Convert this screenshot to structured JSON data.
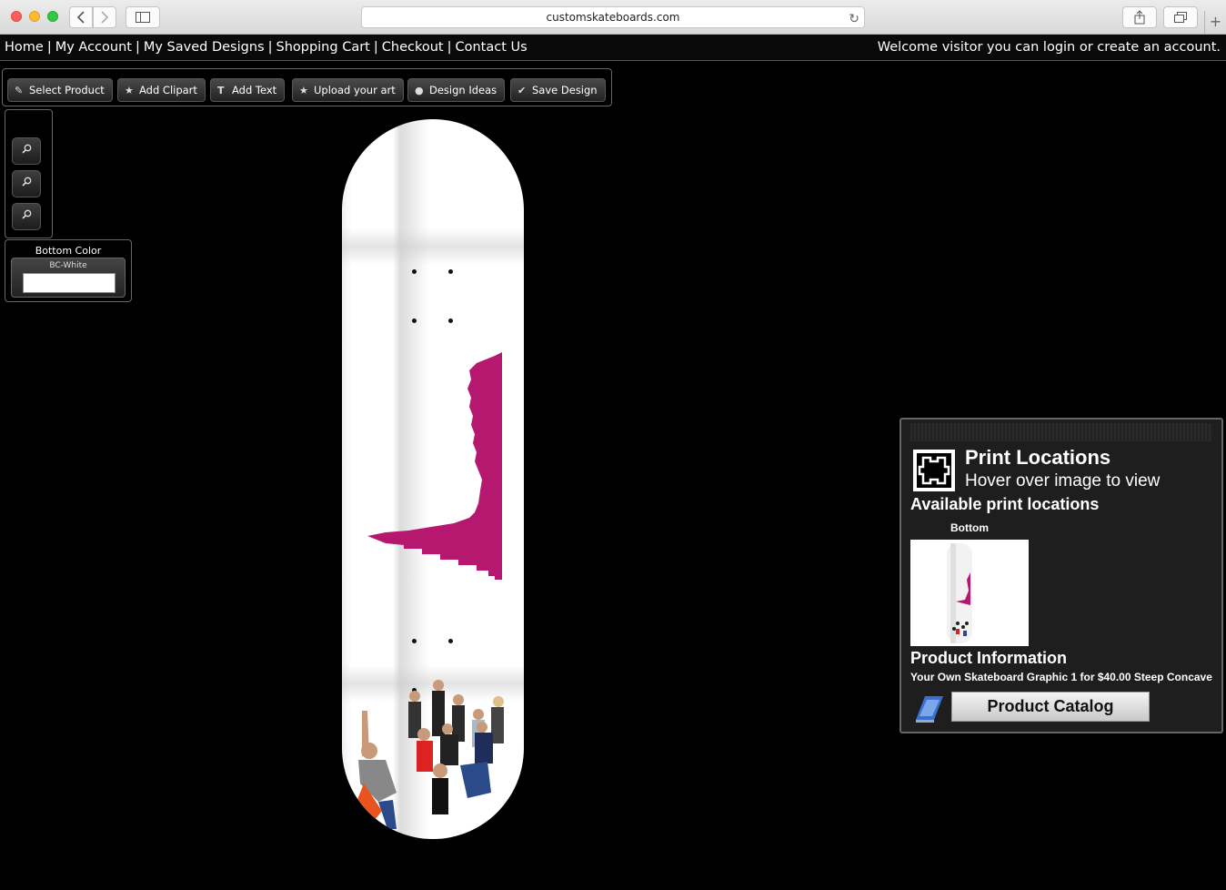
{
  "browser": {
    "url": "customskateboards.com"
  },
  "nav": {
    "links": [
      "Home",
      "My Account",
      "My Saved Designs",
      "Shopping Cart",
      "Checkout",
      "Contact Us"
    ],
    "separator": "|",
    "welcome": "Welcome visitor you can login or create an account."
  },
  "toolbar": {
    "buttons": [
      {
        "label": "Select Product",
        "icon": "pencil-icon"
      },
      {
        "label": "Add Clipart",
        "icon": "star-icon"
      },
      {
        "label": "Add Text",
        "icon": "text-icon"
      },
      {
        "label": "Upload your art",
        "icon": "star-icon"
      },
      {
        "label": "Design Ideas",
        "icon": "bulb-icon"
      },
      {
        "label": "Save Design",
        "icon": "checkmark-icon"
      }
    ]
  },
  "zoom": {
    "icons": [
      "zoom-in-icon",
      "zoom-reset-icon",
      "zoom-out-icon"
    ]
  },
  "bottom_color": {
    "title": "Bottom Color",
    "name": "BC-White",
    "swatch": "#ffffff"
  },
  "design": {
    "accent": "#b5186e",
    "deck_color": "#ffffff"
  },
  "panel": {
    "title": "Print Locations",
    "subtitle": "Hover over image to view",
    "available": "Available print locations",
    "location": "Bottom",
    "product_info_title": "Product Information",
    "product_desc": "Your Own Skateboard Graphic 1 for $40.00 Steep Concave",
    "catalog_button": "Product Catalog"
  }
}
